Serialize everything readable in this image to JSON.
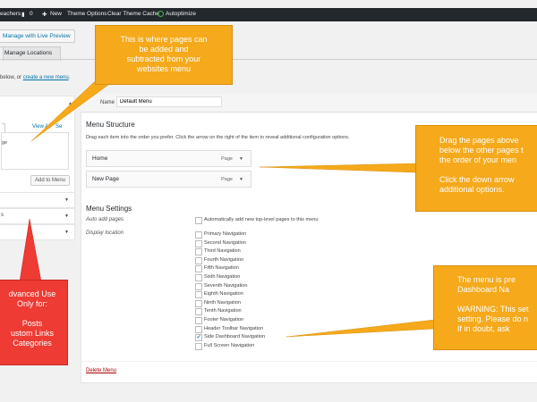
{
  "admin_bar": {
    "left_fragment": "eachers",
    "comments_count": "0",
    "new_label": "New",
    "theme_options": "Theme Options",
    "clear_theme_cache": "Clear Theme Cache",
    "autoptimize": "Autoptimize"
  },
  "top": {
    "manage_live_preview": "Manage with Live Preview",
    "tab_manage_locations": "Manage Locations"
  },
  "intro": {
    "prefix": "below, or ",
    "create_link": "create a new menu",
    "suffix": "."
  },
  "left_panel": {
    "view_all": "View All",
    "search_frag": "Se",
    "item_frag": "ge",
    "add_to_menu": "Add to Menu",
    "sections": [
      "",
      "s",
      ""
    ]
  },
  "menu_name": {
    "label": "Name",
    "value": "Default Menu"
  },
  "menu_structure": {
    "title": "Menu Structure",
    "help": "Drag each item into the order you prefer. Click the arrow on the right of the item to reveal additional configuration options.",
    "items": [
      {
        "title": "Home",
        "type": "Page"
      },
      {
        "title": "New Page",
        "type": "Page"
      }
    ]
  },
  "menu_settings": {
    "title": "Menu Settings",
    "auto_add_label": "Auto add pages",
    "auto_add_text": "Automatically add new top-level pages to this menu",
    "display_location_label": "Display location",
    "locations": [
      {
        "name": "Primary Navigation",
        "checked": false
      },
      {
        "name": "Second Navigation",
        "checked": false
      },
      {
        "name": "Third Navigation",
        "checked": false
      },
      {
        "name": "Fourth Navigation",
        "checked": false
      },
      {
        "name": "Fifth Navigation",
        "checked": false
      },
      {
        "name": "Sixth Navigation",
        "checked": false
      },
      {
        "name": "Seventh Navigation",
        "checked": false
      },
      {
        "name": "Eighth Navigation",
        "checked": false
      },
      {
        "name": "Ninth Navigation",
        "checked": false
      },
      {
        "name": "Tenth Navigation",
        "checked": false
      },
      {
        "name": "Footer Navigation",
        "checked": false
      },
      {
        "name": "Header Toolbar Navigation",
        "checked": false
      },
      {
        "name": "Side Dashboard Navigation",
        "checked": true
      },
      {
        "name": "Full Screen Navigation",
        "checked": false
      }
    ],
    "delete_menu": "Delete Menu"
  },
  "callouts": {
    "top": "This is where pages can\nbe added and\nsubtracted from your\nwebsites menu",
    "right_drag": "Drag the pages above\nbelow the other pages t\nthe order of your men\n\nClick the down arrow\nadditional options.",
    "left_red": "dvanced Use\nOnly for:\n\nPosts\nustom Links\nCategories",
    "bottom_right": "The menu is pre\nDashboard Na\n\nWARNING: This set\nsetting. Please do n\nIf in doubt, ask"
  },
  "colors": {
    "callout_orange": "#f5a91b",
    "callout_red": "#ee3b33",
    "admin_bar": "#23282d",
    "link": "#0073aa",
    "delete": "#a00"
  }
}
